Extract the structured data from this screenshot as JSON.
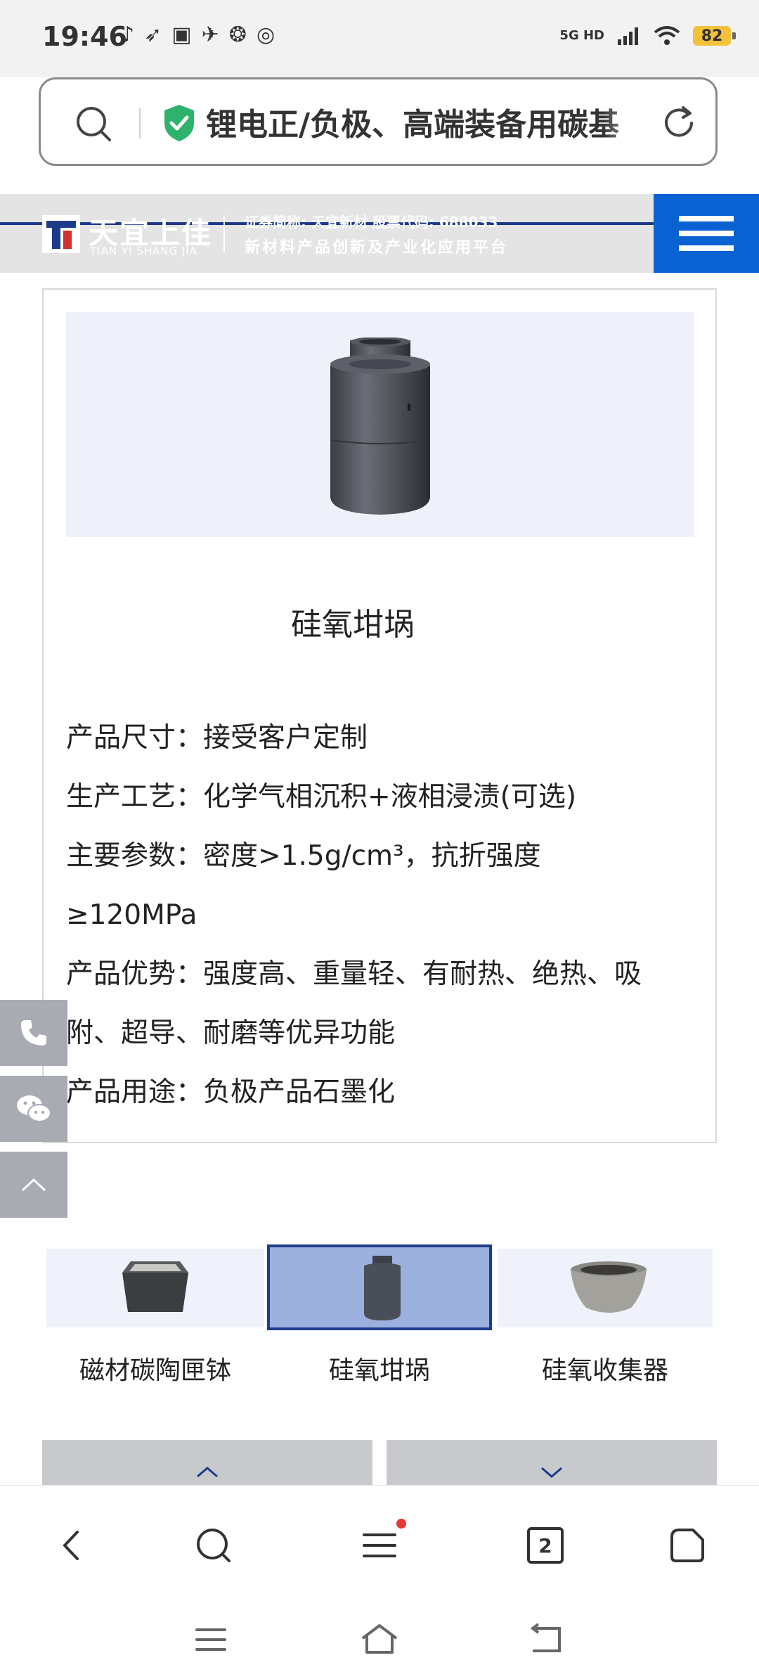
{
  "status_bar": {
    "time": "19:46",
    "network": "5G HD",
    "battery": "82"
  },
  "url_bar": {
    "text": "锂电正/负极、高端装备用碳基"
  },
  "site_header": {
    "logo_cn": "天宜上佳",
    "logo_en": "TIAN YI SHANG JIA",
    "slogan_line1": "证券简称: 天宜新材  股票代码: 688033",
    "slogan_line2": "新材料产品创新及产业化应用平台"
  },
  "product": {
    "title": "硅氧坩埚",
    "specs": {
      "size": "产品尺寸：接受客户定制",
      "process": "生产工艺：化学气相沉积+液相浸渍(可选)",
      "params_line1": "主要参数：密度>1.5g/cm³，抗折强度",
      "params_line2": "≥120MPa",
      "advantage_line1": "产品优势：强度高、重量轻、有耐热、绝热、吸",
      "advantage_line2": "附、超导、耐磨等优异功能",
      "usage": "产品用途：负极产品石墨化"
    }
  },
  "thumbnails": [
    {
      "label": "磁材碳陶匣钵",
      "active": false
    },
    {
      "label": "硅氧坩埚",
      "active": true
    },
    {
      "label": "硅氧收集器",
      "active": false
    }
  ],
  "browser_bar": {
    "tab_count": "2"
  },
  "colors": {
    "brand_blue": "#0a62d2",
    "header_navy": "#1d3a8a",
    "shield_green": "#2db36b",
    "notification_dot": "#e53935"
  }
}
